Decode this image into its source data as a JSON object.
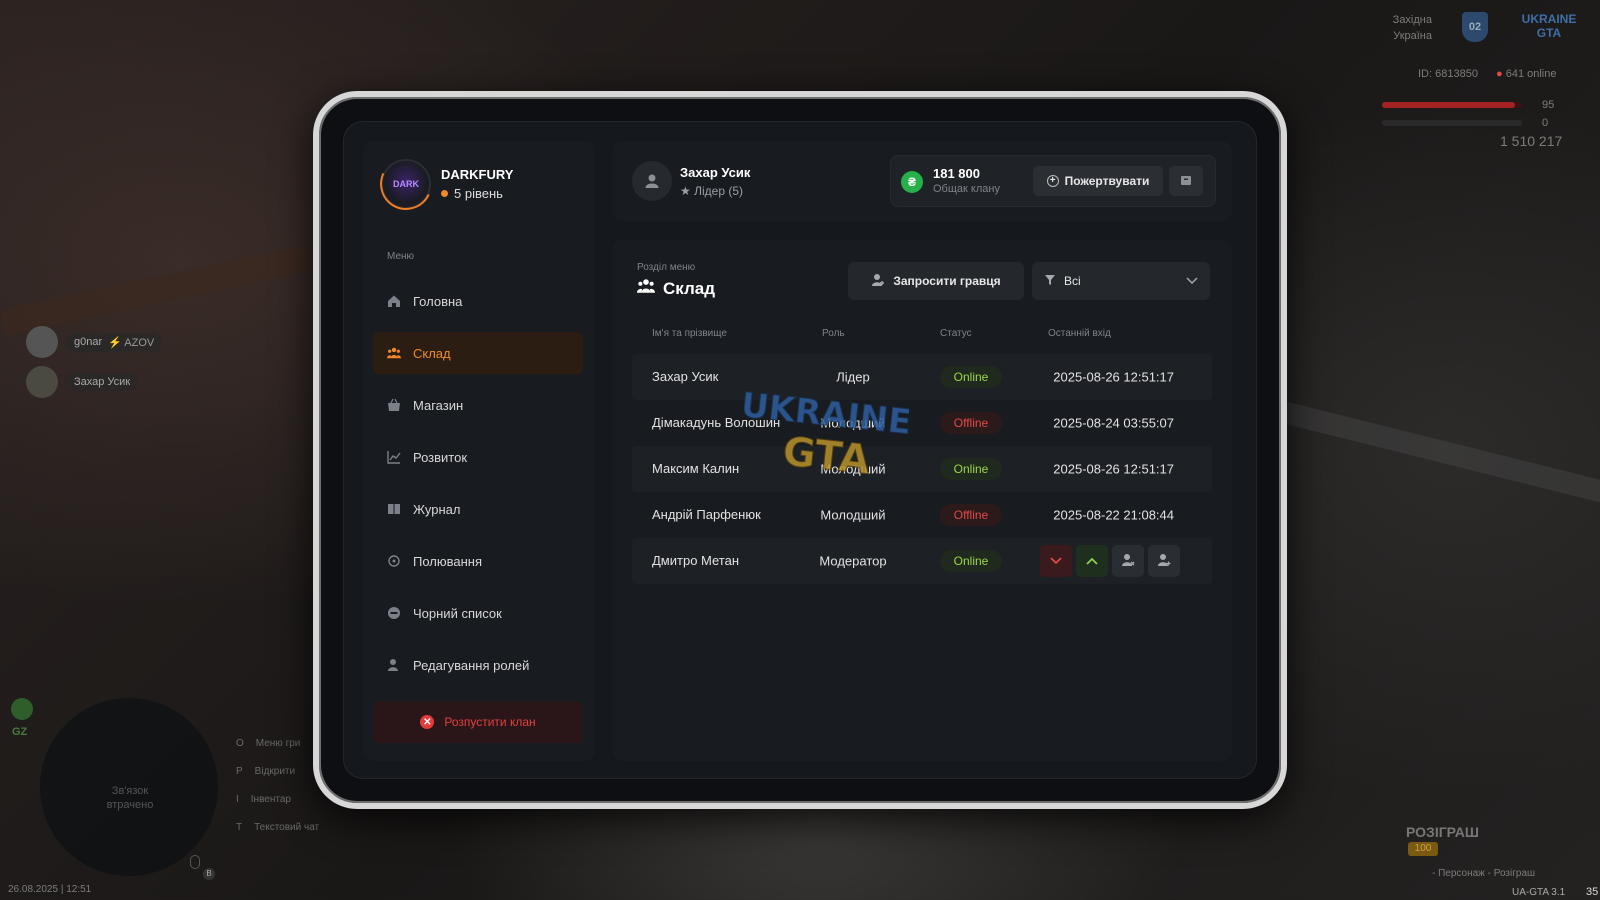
{
  "profile": {
    "name": "DARKFURY",
    "level": "5 рівень",
    "avatar_text": "DARK"
  },
  "menu_label": "Меню",
  "nav": [
    {
      "label": "Головна",
      "icon": "home-icon"
    },
    {
      "label": "Склад",
      "icon": "people-icon",
      "active": true
    },
    {
      "label": "Магазин",
      "icon": "shop-icon"
    },
    {
      "label": "Розвиток",
      "icon": "chart-icon"
    },
    {
      "label": "Журнал",
      "icon": "book-icon"
    },
    {
      "label": "Полювання",
      "icon": "target-icon"
    },
    {
      "label": "Чорний список",
      "icon": "block-icon"
    },
    {
      "label": "Редагування ролей",
      "icon": "user-edit-icon"
    }
  ],
  "disband_label": "Розпустити клан",
  "topbar": {
    "user_name": "Захар Усик",
    "user_role": "Лідер (5)",
    "bank_amount": "181 800",
    "bank_label": "Общак клану",
    "donate_label": "Пожертвувати"
  },
  "main": {
    "section_label": "Розділ меню",
    "section_title": "Склад",
    "invite_label": "Запросити гравця",
    "filter_value": "Всі",
    "columns": [
      "Ім'я та прізвище",
      "Роль",
      "Статус",
      "Останній вхід"
    ],
    "rows": [
      {
        "name": "Захар Усик",
        "role": "Лідер",
        "status": "Online",
        "last": "2025-08-26 12:51:17"
      },
      {
        "name": "Дімакадунь Волошин",
        "role": "Молодший",
        "status": "Offline",
        "last": "2025-08-24 03:55:07"
      },
      {
        "name": "Максим Калин",
        "role": "Молодший",
        "status": "Online",
        "last": "2025-08-26 12:51:17"
      },
      {
        "name": "Андрій Парфенюк",
        "role": "Молодший",
        "status": "Offline",
        "last": "2025-08-22 21:08:44"
      },
      {
        "name": "Дмитро Метан",
        "role": "Модератор",
        "status": "Online",
        "last": ""
      }
    ]
  },
  "hud": {
    "player1": "g0nar",
    "player1_tag": "AZOV",
    "player2": "Захар Усик",
    "region": "Західна Україна",
    "region_code": "02",
    "server_logo": "UKRAINE GTA",
    "id_line": "ID: 6813850",
    "online": "641 online",
    "hp": "95",
    "armor": "0",
    "money": "1 510 217",
    "gz": "GZ",
    "radio_status": "Зв'язок втрачено",
    "hints": [
      {
        "key": "O",
        "text": "Меню гри"
      },
      {
        "key": "P",
        "text": "Відкрити"
      },
      {
        "key": "I",
        "text": "Інвентар"
      },
      {
        "key": "T",
        "text": "Текстовий чат"
      }
    ],
    "mic_key": "B",
    "datetime": "26.08.2025 | 12:51",
    "giveaway": "РОЗІГРАШ",
    "giveaway_badge": "100",
    "giveaway_hint": "- Персонаж - Розіграш",
    "version": "UA-GTA 3.1",
    "fps": "35"
  },
  "colors": {
    "accent": "#f08a2c",
    "online": "#9bd64b",
    "offline": "#e24848",
    "bank": "#26b04a"
  }
}
